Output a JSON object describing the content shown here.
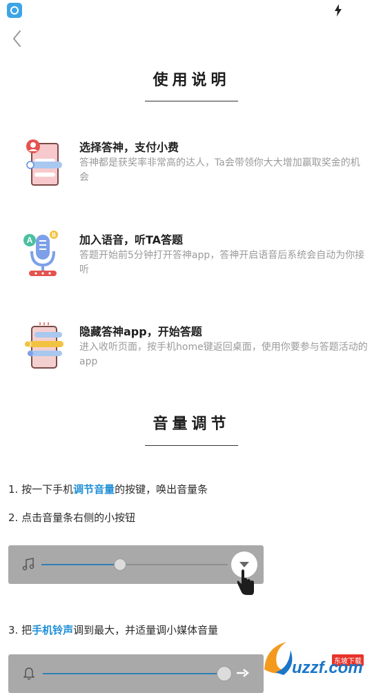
{
  "usage": {
    "title": "使用说明",
    "steps": [
      {
        "title": "选择答神，支付小费",
        "desc": "答神都是获奖率非常高的达人，Ta会带领你大大增加赢取奖金的机会"
      },
      {
        "title": "加入语音，听TA答题",
        "desc": "答题开始前5分钟打开答神app，答神开启语音后系统会自动为你接听"
      },
      {
        "title": "隐藏答神app，开始答题",
        "desc": "进入收听页面，按手机home键返回桌面，使用你要参与答题活动的app"
      }
    ]
  },
  "volume": {
    "title": "音量调节",
    "step1": {
      "prefix": "1. 按一下手机",
      "highlight": "调节音量",
      "suffix": "的按键，唤出音量条"
    },
    "step2": {
      "text": "2. 点击音量条右侧的小按钮"
    },
    "step3": {
      "prefix": "3. 把",
      "highlight": "手机铃声",
      "suffix": "调到最大，并适量调小媒体音量"
    },
    "media_level": 0.42,
    "ringer_level": 1.0
  },
  "watermark": {
    "brand": "uzzf.com",
    "tag": "东坡下载"
  },
  "colors": {
    "highlight": "#1f8fd6",
    "volume_fill": "#2f7fb5",
    "volume_bg": "#a9a9a9"
  },
  "icons": [
    "app-icon",
    "charging-bolt-icon",
    "back-chevron-icon",
    "support-person-icon",
    "microphone-ab-icon",
    "phone-options-icon",
    "music-note-icon",
    "bell-icon",
    "expand-arrow-icon",
    "pointer-hand-icon"
  ]
}
